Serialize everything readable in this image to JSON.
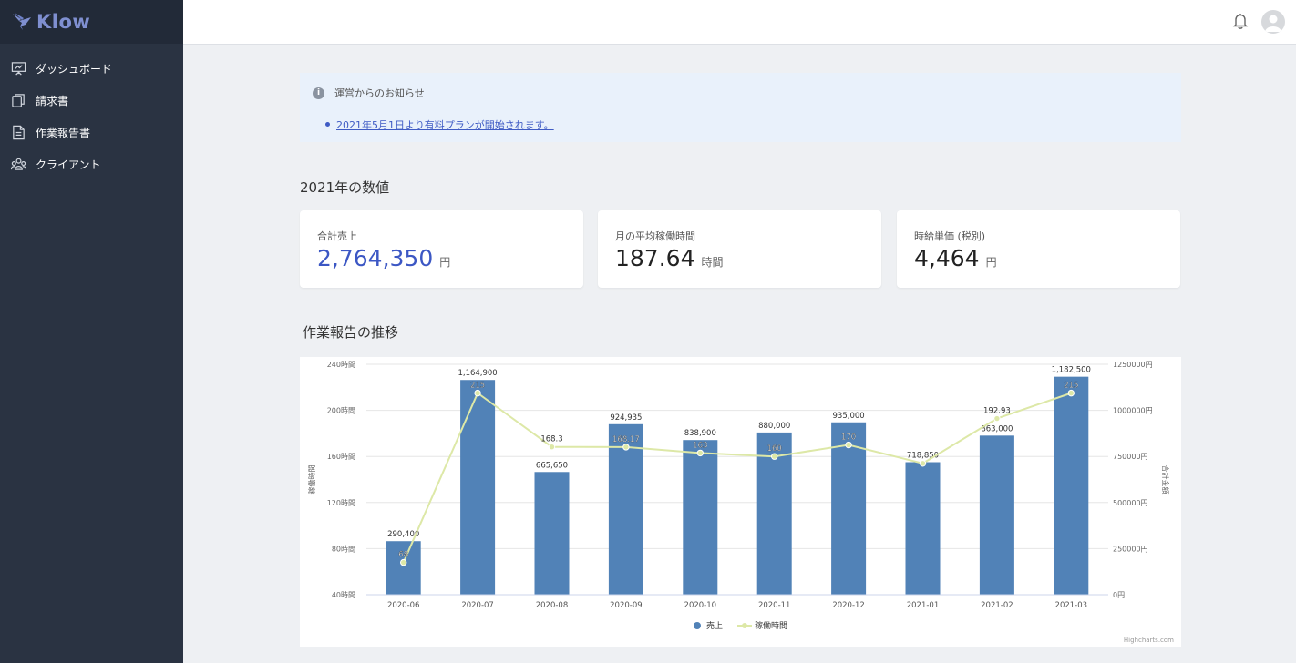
{
  "app": {
    "name": "Klow"
  },
  "sidebar": {
    "items": [
      {
        "label": "ダッシュボード",
        "icon": "presentation-chart-icon"
      },
      {
        "label": "請求書",
        "icon": "documents-icon"
      },
      {
        "label": "作業報告書",
        "icon": "file-text-icon"
      },
      {
        "label": "クライアント",
        "icon": "users-icon"
      }
    ]
  },
  "header": {
    "notification_icon": "bell-icon",
    "avatar_icon": "user-avatar-icon"
  },
  "notice": {
    "title": "運営からのお知らせ",
    "items": [
      "2021年5月1日より有料プランが開始されます。"
    ]
  },
  "stats": {
    "heading": "2021年の数値",
    "cards": [
      {
        "label": "合計売上",
        "value": "2,764,350",
        "unit": "円"
      },
      {
        "label": "月の平均稼働時間",
        "value": "187.64",
        "unit": "時間"
      },
      {
        "label": "時給単価 (税別)",
        "value": "4,464",
        "unit": "円"
      }
    ]
  },
  "chart_section": {
    "heading": "作業報告の推移"
  },
  "chart_data": {
    "type": "bar",
    "categories": [
      "2020-06",
      "2020-07",
      "2020-08",
      "2020-09",
      "2020-10",
      "2020-11",
      "2020-12",
      "2021-01",
      "2021-02",
      "2021-03"
    ],
    "series": [
      {
        "name": "売上",
        "type": "bar",
        "axis": "right",
        "color": "#5182b7",
        "values": [
          290400,
          1164900,
          665650,
          924935,
          838900,
          880000,
          935000,
          718850,
          863000,
          1182500
        ],
        "labels": [
          "290,400",
          "1,164,900",
          "665,650",
          "924,935",
          "838,900",
          "880,000",
          "935,000",
          "718,850",
          "863,000",
          "1,182,500"
        ]
      },
      {
        "name": "稼働時間",
        "type": "line",
        "axis": "left",
        "color": "#dde8a7",
        "values": [
          68,
          215,
          168.3,
          168.17,
          163,
          160,
          170,
          154,
          192.93,
          215
        ],
        "labels": [
          "68",
          "215",
          "168.3",
          "168.17",
          "163",
          "160",
          "170",
          "",
          "192.93",
          "215"
        ]
      }
    ],
    "y_left": {
      "title": "稼働時間",
      "min": 40,
      "max": 240,
      "ticks": [
        "40時間",
        "80時間",
        "120時間",
        "160時間",
        "200時間",
        "240時間"
      ]
    },
    "y_right": {
      "title": "合計金額",
      "min": 0,
      "max": 1250000,
      "ticks": [
        "0円",
        "250000円",
        "500000円",
        "750000円",
        "1000000円",
        "1250000円"
      ]
    },
    "legend": {
      "position": "bottom-center",
      "items": [
        "売上",
        "稼働時間"
      ]
    },
    "credits": "Highcharts.com",
    "grid": true
  }
}
